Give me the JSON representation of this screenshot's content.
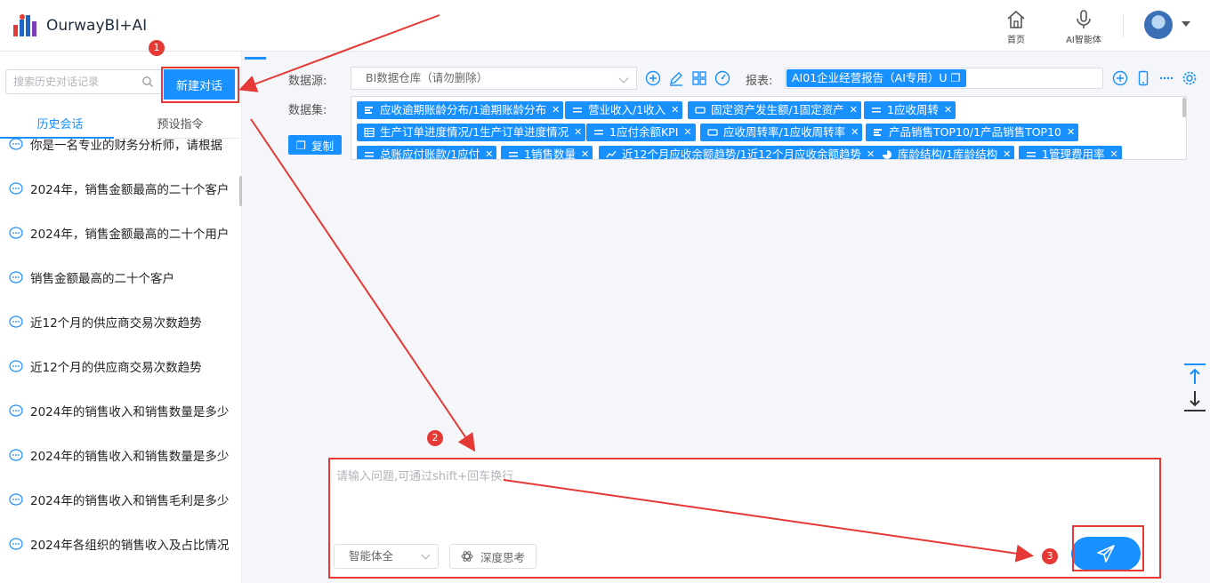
{
  "app": {
    "name": "OurwayBI+AI"
  },
  "header": {
    "home_label": "首页",
    "agent_label": "AI智能体"
  },
  "sidebar": {
    "search_placeholder": "搜索历史对话记录",
    "new_chat_label": "新建对话",
    "tabs": [
      "历史会话",
      "预设指令"
    ],
    "history": [
      "你是一名专业的财务分析师，请根据",
      "2024年，销售金额最高的二十个客户",
      "2024年，销售金额最高的二十个用户",
      "销售金额最高的二十个客户",
      "近12个月的供应商交易次数趋势",
      "近12个月的供应商交易次数趋势",
      "2024年的销售收入和销售数量是多少",
      "2024年的销售收入和销售数量是多少",
      "2024年的销售收入和销售毛利是多少",
      "2024年各组织的销售收入及占比情况"
    ]
  },
  "config": {
    "datasource_label": "数据源:",
    "datasource_value": "BI数据仓库（请勿删除）",
    "report_label": "报表:",
    "report_value": "AI01企业经营报告（AI专用）U",
    "dataset_label": "数据集:",
    "copy_label": "复制",
    "datasets": [
      {
        "label": "应收逾期账龄分布/1逾期账龄分布",
        "icon": "bar-chart-icon"
      },
      {
        "label": "营业收入/1收入",
        "icon": "kpi-icon"
      },
      {
        "label": "固定资产发生额/1固定资产",
        "icon": "card-icon"
      },
      {
        "label": "1应收周转",
        "icon": "kpi-icon"
      },
      {
        "label": "生产订单进度情况/1生产订单进度情况",
        "icon": "table-icon"
      },
      {
        "label": "1应付余额KPI",
        "icon": "kpi-icon"
      },
      {
        "label": "应收周转率/1应收周转率",
        "icon": "card-icon"
      },
      {
        "label": "产品销售TOP10/1产品销售TOP10",
        "icon": "bar-chart-icon"
      },
      {
        "label": "总账应付账款/1应付",
        "icon": "kpi-icon"
      },
      {
        "label": "1销售数量",
        "icon": "kpi-icon"
      },
      {
        "label": "近12个月应收余额趋势/1近12个月应收余额趋势",
        "icon": "line-chart-icon"
      },
      {
        "label": "库龄结构/1库龄结构",
        "icon": "pie-chart-icon"
      },
      {
        "label": "1管理费用率",
        "icon": "kpi-icon"
      }
    ]
  },
  "input": {
    "placeholder": "请输入问题,可通过shift+回车换行",
    "mode_value": "智能体全",
    "deep_think_label": "深度思考"
  },
  "annotations": {
    "badges": [
      "1",
      "2",
      "3"
    ],
    "color": "#e53935"
  },
  "colors": {
    "accent": "#1890ff",
    "annotation": "#e53935"
  }
}
